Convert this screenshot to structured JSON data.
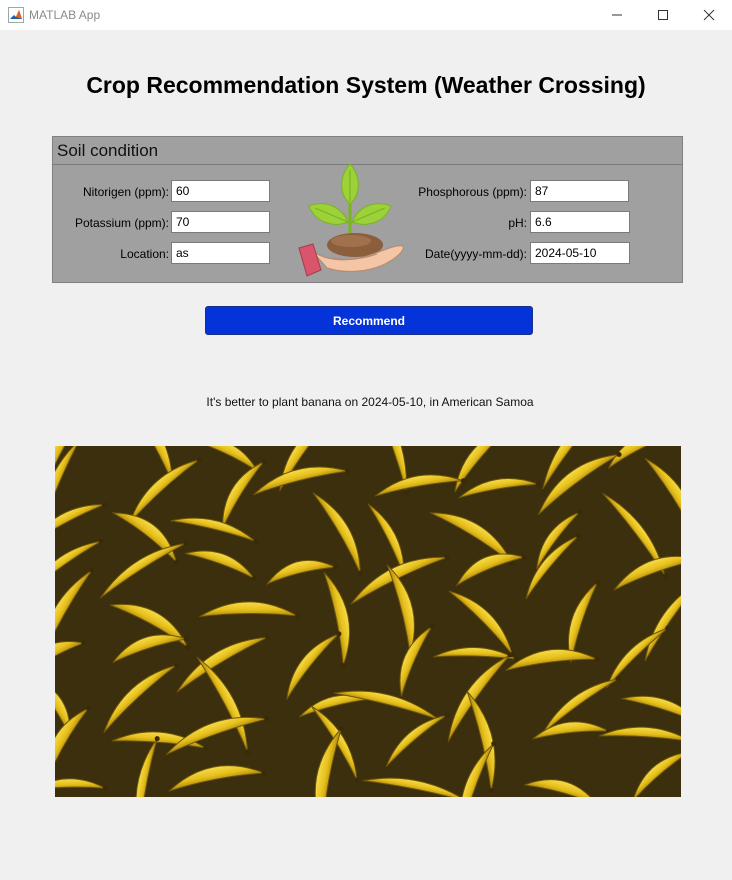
{
  "window": {
    "title": "MATLAB App",
    "icon": "matlab-logo-icon",
    "controls": [
      "minimize-icon",
      "maximize-icon",
      "close-icon"
    ]
  },
  "app": {
    "title": "Crop Recommendation System (Weather Crossing)"
  },
  "soil_panel": {
    "title": "Soil condition",
    "fields": {
      "nitrogen": {
        "label": "Nitorigen (ppm):",
        "value": "60"
      },
      "potassium": {
        "label": "Potassium (ppm):",
        "value": "70"
      },
      "location": {
        "label": "Location:",
        "value": "as"
      },
      "phosphorous": {
        "label": "Phosphorous (ppm):",
        "value": "87"
      },
      "ph": {
        "label": "pH:",
        "value": "6.6"
      },
      "date": {
        "label": "Date(yyyy-mm-dd):",
        "value": "2024-05-10"
      }
    },
    "illustration": "plant-in-hand-icon"
  },
  "recommend_button": {
    "label": "Recommend",
    "color": "#0433d9"
  },
  "result": {
    "message": "It's better to plant banana on 2024-05-10, in American Samoa",
    "image": "banana-pile-photo"
  },
  "colors": {
    "background": "#f0f0f0",
    "panel": "#a0a0a0",
    "banana_yellow": "#e8c21a"
  }
}
